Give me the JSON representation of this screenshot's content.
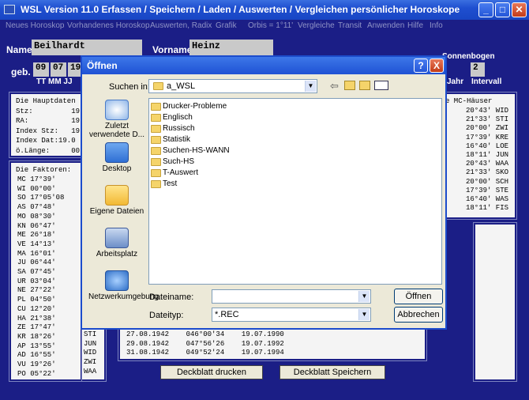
{
  "window": {
    "title": "WSL Version 11.0    Erfassen / Speichern / Laden / Auswerten / Vergleichen persönlicher Horoskope"
  },
  "menu": [
    "Neues Horoskop",
    "Vorhandenes Horoskop",
    "Auswerten, Radix",
    "Grafik",
    "Orbis = 1°11'",
    "Vergleiche",
    "Transit",
    "Anwenden",
    "Hilfe",
    "Info"
  ],
  "form": {
    "name_label": "Name",
    "name_value": "Beilhardt",
    "vorname_label": "Vorname",
    "vorname_value": "Heinz",
    "geb_label": "geb.",
    "day": "09",
    "month": "07",
    "year": "19",
    "tt_mm_jj": "TT MM JJ",
    "sonnenbogen_label": "Sonnenbogen",
    "sonnenbogen_value": "2",
    "jahr_label": "Jahr",
    "intervall_label": "Intervall"
  },
  "hauptdaten": {
    "lines": [
      "Die Hauptdaten",
      "Stz:         19",
      "RA:          19",
      "Index Stz:   19",
      "Index Dat:19.0",
      "ö.Länge:     00"
    ]
  },
  "faktoren": {
    "title": "Die Faktoren:",
    "rows": [
      [
        "MC",
        "17°39'"
      ],
      [
        "WI",
        "00°00'"
      ],
      [
        "SO",
        "17°05'08"
      ],
      [
        "AS",
        "07°48'"
      ],
      [
        "MO",
        "08°30'"
      ],
      [
        "KN",
        "06°47'"
      ],
      [
        "ME",
        "26°18'"
      ],
      [
        "VE",
        "14°13'"
      ],
      [
        "MA",
        "16°01'"
      ],
      [
        "JU",
        "06°44'"
      ],
      [
        "SA",
        "07°45'"
      ],
      [
        "UR",
        "03°04'"
      ],
      [
        "NE",
        "27°22'"
      ],
      [
        "PL",
        "04°50'"
      ],
      [
        "CU",
        "12°20'"
      ],
      [
        "HA",
        "21°38'"
      ],
      [
        "ZE",
        "17°47'"
      ],
      [
        "KR",
        "18°26'"
      ],
      [
        "AP",
        "13°55'"
      ],
      [
        "AD",
        "16°55'"
      ],
      [
        "VU",
        "19°26'"
      ],
      [
        "PO",
        "05°22'"
      ]
    ],
    "signs": [
      "STI",
      "JUN",
      "WID",
      "ZWI",
      "WAA"
    ]
  },
  "haeuser": {
    "title": "e MC-Häuser",
    "rows": [
      "20°43' WID",
      "21°33' STI",
      "20°00' ZWI",
      "17°39' KRE",
      "16°40' LOE",
      "18°11' JUN",
      "20°43' WAA",
      "21°33' SKO",
      "20°00' SCH",
      "17°39' STE",
      "16°40' WAS",
      "18°11' FIS"
    ]
  },
  "dates": [
    [
      "27.08.1942",
      "046°00'34",
      "19.07.1990"
    ],
    [
      "29.08.1942",
      "047°56'26",
      "19.07.1992"
    ],
    [
      "31.08.1942",
      "049°52'24",
      "19.07.1994"
    ]
  ],
  "buttons": {
    "deckblatt_drucken": "Deckblatt drucken",
    "deckblatt_speichern": "Deckblatt Speichern"
  },
  "dialog": {
    "title": "Öffnen",
    "lookin_label": "Suchen in:",
    "lookin_value": "a_WSL",
    "places": [
      "Zuletzt verwendete D...",
      "Desktop",
      "Eigene Dateien",
      "Arbeitsplatz",
      "Netzwerkumgebung"
    ],
    "folders": [
      "Drucker-Probleme",
      "Englisch",
      "Russisch",
      "Statistik",
      "Suchen-HS-WANN",
      "Such-HS",
      "T-Auswert",
      "Test"
    ],
    "filename_label": "Dateiname:",
    "filename_value": "",
    "filetype_label": "Dateityp:",
    "filetype_value": "*.REC",
    "open_button": "Öffnen",
    "cancel_button": "Abbrechen",
    "help_button": "?",
    "close_button": "X"
  }
}
